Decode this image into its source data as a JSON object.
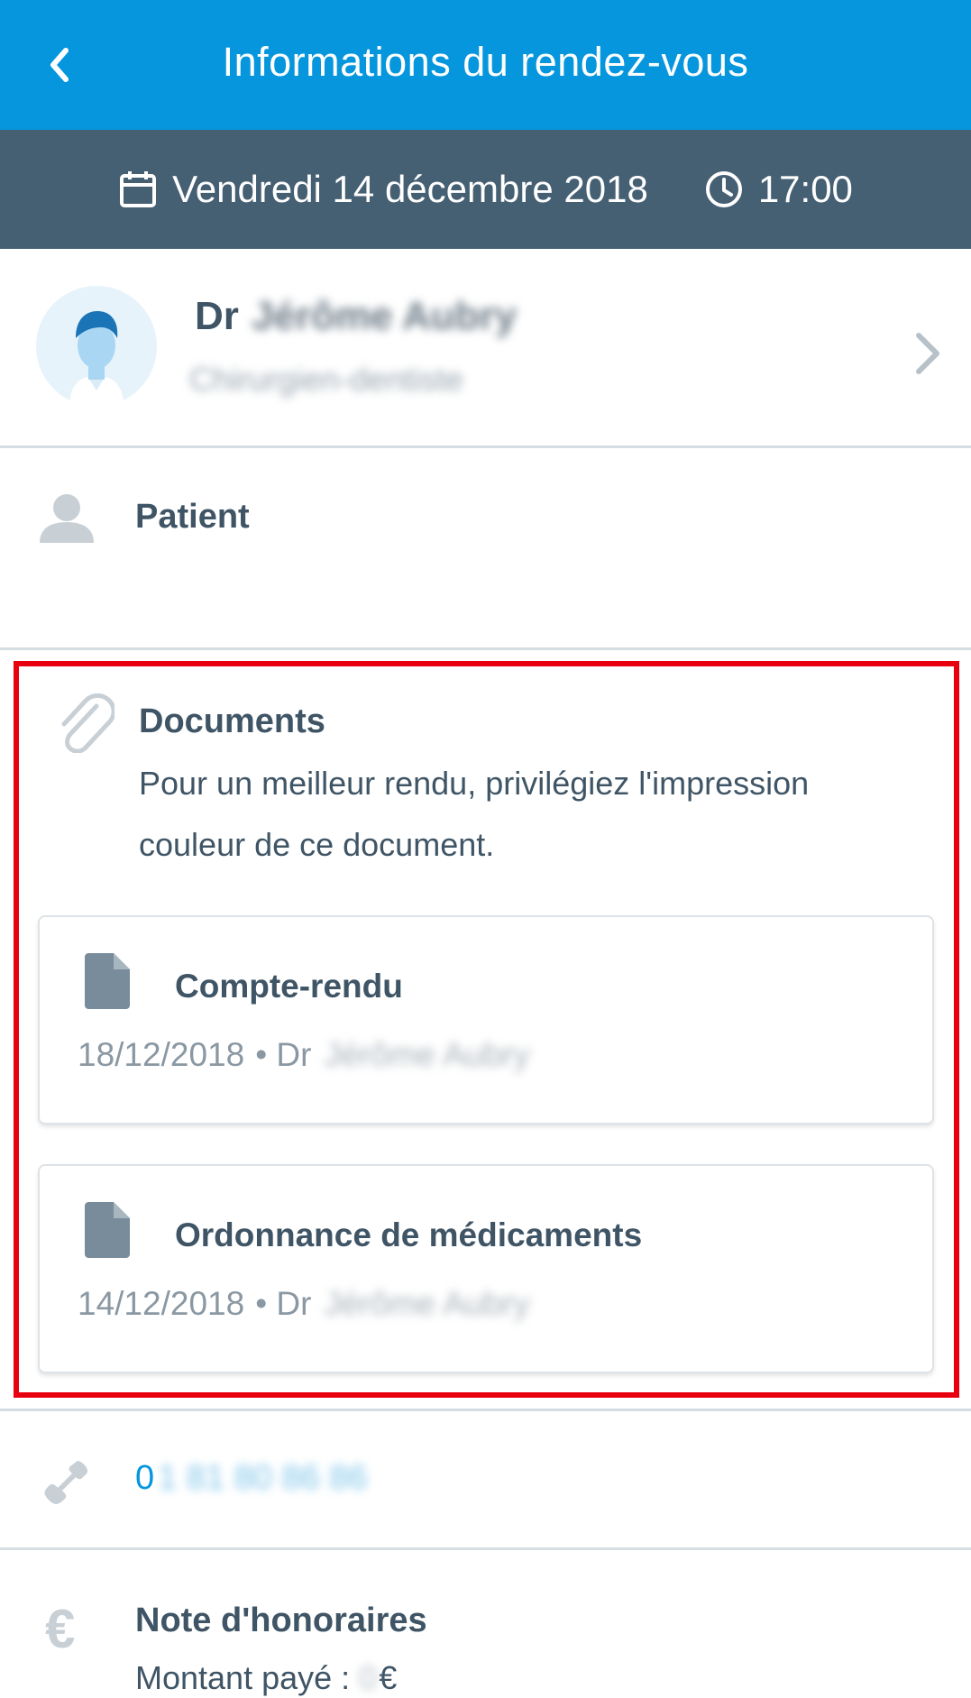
{
  "header": {
    "title": "Informations du rendez-vous",
    "back_icon": "chevron-left-icon"
  },
  "appointment": {
    "date": "Vendredi 14 décembre 2018",
    "time": "17:00"
  },
  "doctor": {
    "prefix": "Dr",
    "name": "Jérôme Aubry",
    "specialty": "Chirurgien-dentiste"
  },
  "patient": {
    "label": "Patient"
  },
  "documents": {
    "title": "Documents",
    "description": "Pour un meilleur rendu, privilégiez l'impression couleur de ce document.",
    "items": [
      {
        "title": "Compte-rendu",
        "date": "18/12/2018",
        "doctor_prefix": "• Dr",
        "doctor_name": "Jérôme Aubry"
      },
      {
        "title": "Ordonnance de médicaments",
        "date": "14/12/2018",
        "doctor_prefix": "• Dr",
        "doctor_name": "Jérôme Aubry"
      }
    ]
  },
  "contact": {
    "phone_prefix": "0",
    "phone_masked": "1 81 80 86 86"
  },
  "fees": {
    "title": "Note d'honoraires",
    "amount_label": "Montant payé :",
    "amount_value": "0",
    "currency": "€"
  },
  "colors": {
    "header_blue": "#0596de",
    "date_bar": "#455f73",
    "highlight_red": "#e8000e",
    "text_dark": "#3f5566",
    "text_muted": "#8a98a3"
  }
}
